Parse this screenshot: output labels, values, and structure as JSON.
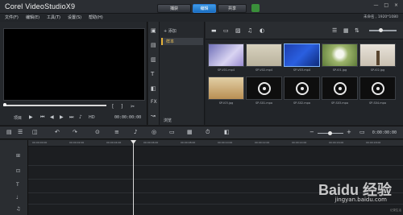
{
  "titlebar": {
    "app_title": "Corel VideoStudioX9",
    "tabs": [
      "捕获",
      "编辑",
      "共享"
    ],
    "active_tab": "编辑",
    "window_controls": [
      "—",
      "□",
      "×"
    ]
  },
  "menu": {
    "items": [
      "文件(F)",
      "编辑(E)",
      "工具(T)",
      "设置(S)",
      "帮助(H)"
    ],
    "project_info": "未命名 , 1920*1080"
  },
  "preview": {
    "mode_label": "项目",
    "hd_label": "HD",
    "timecode": "00:00:00:00"
  },
  "library": {
    "add_label": "+ 添加",
    "folder": "样本",
    "browse_label": "浏览",
    "thumbnails": [
      {
        "label": "SP-V01.mp4",
        "kind": "purple",
        "selected": false
      },
      {
        "label": "SP-V02.mp4",
        "kind": "beige",
        "selected": false
      },
      {
        "label": "SP-V03.mp4",
        "kind": "blue",
        "selected": true
      },
      {
        "label": "SP-I01.jpg",
        "kind": "dandelion",
        "selected": false
      },
      {
        "label": "SP-I02.jpg",
        "kind": "tree",
        "selected": false
      },
      {
        "label": "SP-I03.jpg",
        "kind": "branch",
        "selected": false
      },
      {
        "label": "SP-S01.mpa",
        "kind": "disc",
        "selected": false
      },
      {
        "label": "SP-S02.mpa",
        "kind": "disc",
        "selected": false
      },
      {
        "label": "SP-S03.mpa",
        "kind": "disc",
        "selected": false
      },
      {
        "label": "SP-S04.mpa",
        "kind": "disc",
        "selected": false
      }
    ]
  },
  "timeline": {
    "timecode": "0:00:00:00",
    "ruler": [
      "00:00:00:00",
      "00:00:02:00",
      "00:00:04:00",
      "00:00:06:00",
      "00:00:08:00",
      "00:00:10:00",
      "00:00:12:00",
      "00:00:14:00",
      "00:00:16:00",
      "00:00:18:00"
    ]
  },
  "watermark": {
    "brand": "Baidu 经验",
    "sub": "jingyan.baidu.com"
  },
  "corner_tag": "记录生活"
}
